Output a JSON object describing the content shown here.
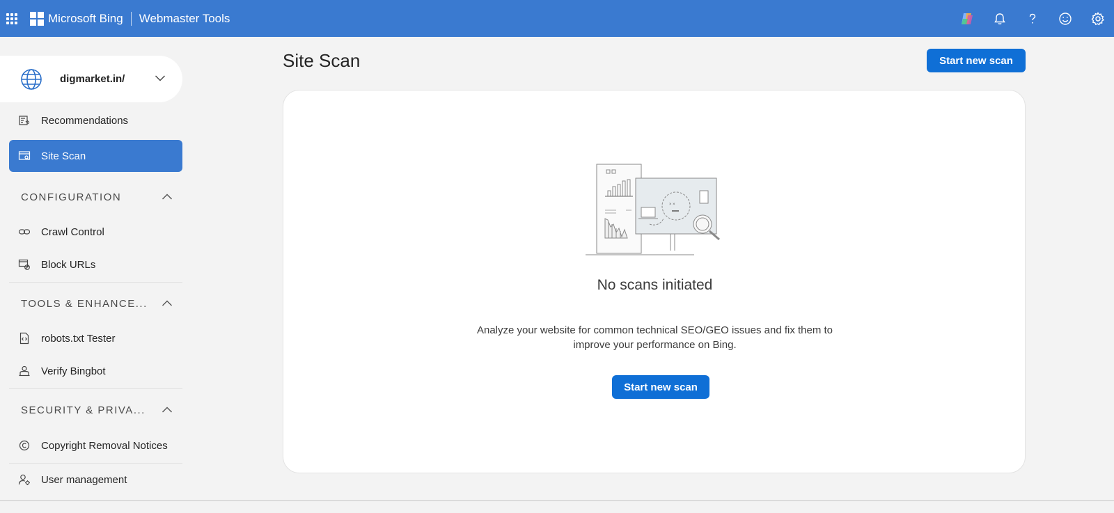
{
  "header": {
    "brand": "Microsoft Bing",
    "product": "Webmaster Tools",
    "icons": [
      "waffle-icon",
      "copilot-icon",
      "bell-icon",
      "help-icon",
      "feedback-smiley-icon",
      "gear-icon"
    ]
  },
  "sidebar": {
    "site": "digmarket.in/",
    "items_top": [
      {
        "label": "Recommendations",
        "icon": "recommendations-icon"
      },
      {
        "label": "Site Scan",
        "icon": "site-scan-icon",
        "active": true
      }
    ],
    "sections": [
      {
        "title": "CONFIGURATION",
        "items": [
          {
            "label": "Crawl Control",
            "icon": "link-icon"
          },
          {
            "label": "Block URLs",
            "icon": "block-urls-icon"
          }
        ]
      },
      {
        "title": "TOOLS & ENHANCE...",
        "items": [
          {
            "label": "robots.txt Tester",
            "icon": "code-file-icon"
          },
          {
            "label": "Verify Bingbot",
            "icon": "bot-icon"
          }
        ]
      },
      {
        "title": "SECURITY & PRIVA...",
        "items": [
          {
            "label": "Copyright Removal Notices",
            "icon": "copyright-icon"
          }
        ]
      }
    ],
    "footer_item": {
      "label": "User management",
      "icon": "user-settings-icon"
    }
  },
  "main": {
    "title": "Site Scan",
    "start_button": "Start new scan",
    "empty": {
      "title": "No scans initiated",
      "description": "Analyze your website for common technical SEO/GEO issues and fix them to improve your performance on Bing.",
      "button": "Start new scan"
    }
  },
  "colors": {
    "topbar": "#3a7ad0",
    "primary_button": "#0f6fd6",
    "active_nav": "#3a7ad0",
    "page_bg": "#f3f3f3"
  }
}
